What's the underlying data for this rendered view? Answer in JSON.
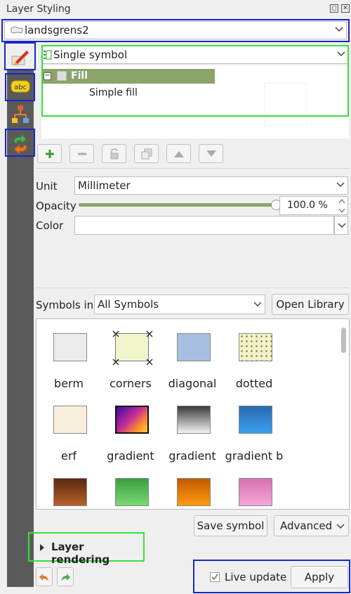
{
  "window": {
    "title": "Layer Styling"
  },
  "layer_selector": {
    "value": "landsgrens2"
  },
  "renderer_selector": {
    "value": "Single symbol"
  },
  "symbol_tree": {
    "root": "Fill",
    "child": "Simple fill"
  },
  "symbol_toolbar": [
    "add-layer",
    "remove-layer",
    "lock-layer",
    "duplicate-layer",
    "move-up",
    "move-down"
  ],
  "properties": {
    "unit_label": "Unit",
    "unit_value": "Millimeter",
    "opacity_label": "Opacity",
    "opacity_value": "100.0 %",
    "opacity_fraction": 1.0,
    "color_label": "Color"
  },
  "library": {
    "symbols_in_label": "Symbols in",
    "symbols_in_value": "All Symbols",
    "open_library": "Open Library",
    "symbols": [
      {
        "label": "berm",
        "color": "#ececec"
      },
      {
        "label": "corners",
        "color": "#f0f5cc"
      },
      {
        "label": "diagonal",
        "color": "#a6bfe0"
      },
      {
        "label": "dotted",
        "color": "#f2f2c8"
      },
      {
        "label": "erf",
        "color": "#f7eedb"
      },
      {
        "label": "gradient",
        "color": "#6a1fb3"
      },
      {
        "label": "gradient",
        "color": "#8c8c8c"
      },
      {
        "label": "gradient b",
        "color": "#3080d0"
      },
      {
        "label": "",
        "color": "#8a3d1a"
      },
      {
        "label": "",
        "color": "#3cb34a"
      },
      {
        "label": "",
        "color": "#e07c00"
      },
      {
        "label": "",
        "color": "#e68ac0"
      }
    ]
  },
  "actions": {
    "save_symbol": "Save symbol",
    "advanced": "Advanced"
  },
  "layer_rendering": {
    "label": "Layer rendering"
  },
  "footer": {
    "live_update": "Live update",
    "live_update_checked": true,
    "apply": "Apply"
  }
}
